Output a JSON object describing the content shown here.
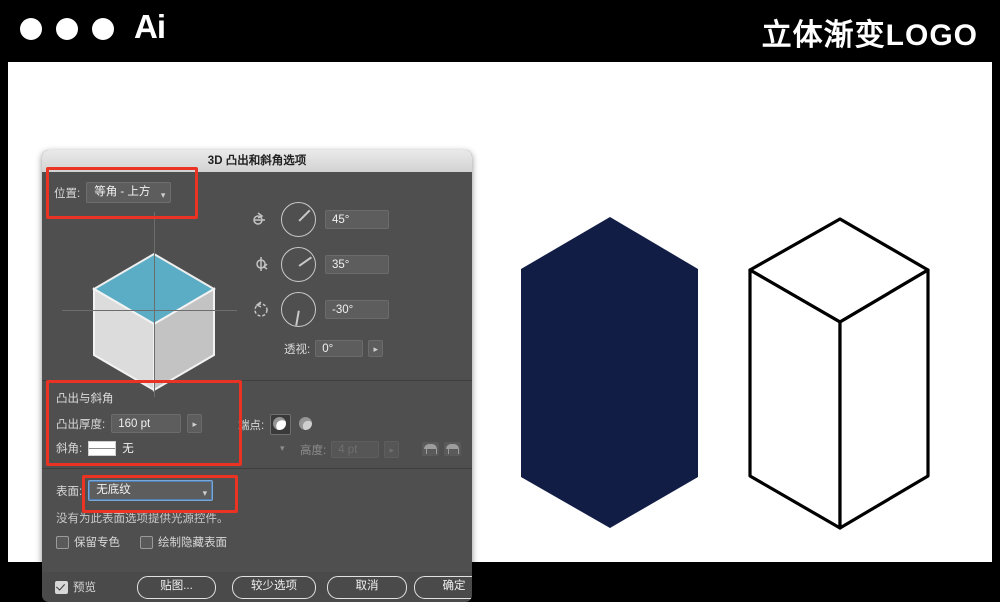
{
  "window": {
    "app_badge": "Ai",
    "title": "立体渐变LOGO",
    "traffic_lights": [
      "close",
      "minimize",
      "zoom"
    ]
  },
  "dialog": {
    "title": "3D 凸出和斜角选项",
    "position": {
      "label": "位置:",
      "value": "等角 - 上方",
      "dropdown_icon": "chevron-down-icon"
    },
    "rotation": {
      "x": {
        "icon": "rotate-x-icon",
        "value": "45°"
      },
      "y": {
        "icon": "rotate-y-icon",
        "value": "35°"
      },
      "z": {
        "icon": "rotate-z-icon",
        "value": "-30°"
      }
    },
    "perspective": {
      "label": "透视:",
      "value": "0°",
      "stepper_icon": "chevron-right-icon"
    },
    "extrude": {
      "section_title": "凸出与斜角",
      "depth_label": "凸出厚度:",
      "depth_value": "160 pt",
      "depth_stepper_icon": "chevron-right-icon",
      "cap_label": "端点:",
      "cap_solid_icon": "cap-solid-icon",
      "cap_hollow_icon": "cap-hollow-icon",
      "bevel_label": "斜角:",
      "bevel_value": "无",
      "bevel_swatch_icon": "bevel-none-swatch-icon",
      "bevel_dropdown_icon": "chevron-down-icon",
      "height_label": "高度:",
      "height_value": "4 pt",
      "height_stepper_icon": "chevron-right-icon",
      "bevel_outward_icon": "bevel-extent-out-icon",
      "bevel_inward_icon": "bevel-extent-in-icon"
    },
    "surface": {
      "label": "表面:",
      "value": "无底纹",
      "dropdown_icon": "chevron-down-icon",
      "note": "没有为此表面选项提供光源控件。",
      "checkbox_spot": {
        "label": "保留专色",
        "checked": false
      },
      "checkbox_hidden": {
        "label": "绘制隐藏表面",
        "checked": false
      }
    },
    "footer": {
      "preview_label": "预览",
      "preview_checked": true,
      "map_art_button": "贴图...",
      "fewer_options_button": "较少选项",
      "cancel_button": "取消",
      "ok_button": "确定"
    },
    "highlights": [
      {
        "name": "position-highlight"
      },
      {
        "name": "extrude-highlight"
      },
      {
        "name": "surface-highlight"
      }
    ]
  },
  "preview_cube": {
    "top_face_color": "#5aadc4",
    "left_face_color": "#d8d8d8",
    "right_face_color": "#c2c2c2"
  },
  "artwork": {
    "filled_shape": {
      "name": "navy-hex-prism",
      "color": "#111d45"
    },
    "outline_shape": {
      "name": "wireframe-box",
      "stroke": "#000000",
      "fill": "#ffffff"
    }
  }
}
